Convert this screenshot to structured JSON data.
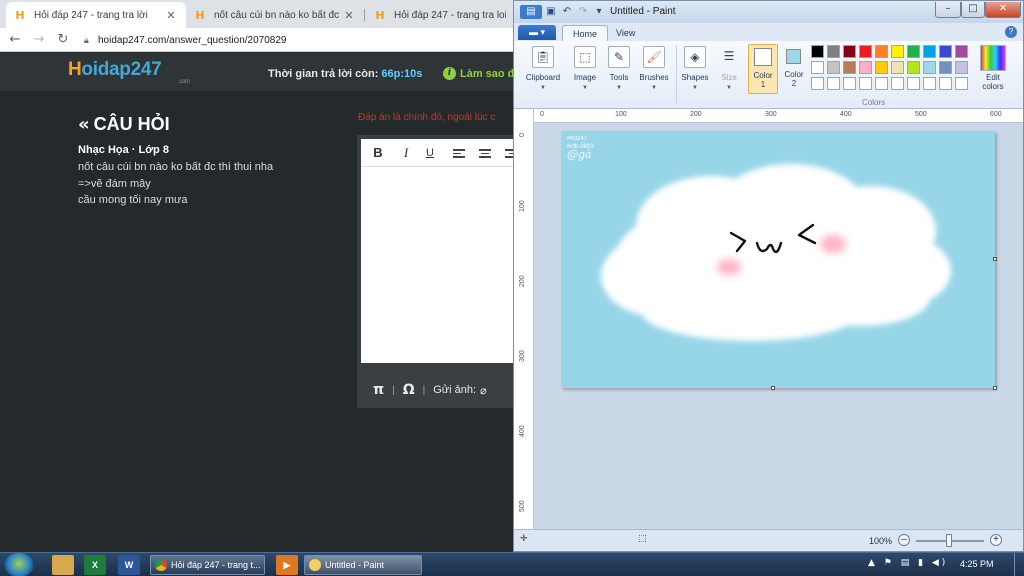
{
  "browser": {
    "tabs": [
      {
        "title": "Hỏi đáp 247 - trang tra lời",
        "close": "✕"
      },
      {
        "title": "nốt câu cúi bn nào ko bất đc thì t",
        "close": "✕"
      },
      {
        "title": "Hỏi đáp 247 - trang tra loi",
        "close": ""
      }
    ],
    "url": "hoidap247.com/answer_question/2070829"
  },
  "site": {
    "logo_h": "H",
    "logo_rest": "oidap247",
    "logo_sub": ".com",
    "timer_label": "Thời gian trả lời còn: ",
    "timer_value": "66p:10s",
    "help_label": "Làm sao đ"
  },
  "question": {
    "heading": "CÂU HỎI",
    "meta": "Nhạc Họa · Lớp 8",
    "lines": [
      "nốt câu cúi bn nào ko bất đc thì thui nha",
      "=>vẽ đám mây",
      "cầu mong tối nay mưa"
    ],
    "answer_note": "Đáp án là chính đó, ngoài lúc c"
  },
  "editor": {
    "bold": "B",
    "italic": "I",
    "underline": "U",
    "pi": "π",
    "omega": "Ω",
    "send_image": "Gửi ảnh:"
  },
  "paint": {
    "title": "Untitled - Paint",
    "tabs": [
      "Home",
      "View"
    ],
    "groups": [
      "Clipboard",
      "Image",
      "Tools",
      "Brushes",
      "Shapes",
      "Size"
    ],
    "color1_label": "Color\n1",
    "color2_label": "Color\n2",
    "colors_label": "Colors",
    "edit_colors": "Edit\ncolors",
    "palette": [
      "#000000",
      "#7f7f7f",
      "#880015",
      "#ed1c24",
      "#ff7f27",
      "#fff200",
      "#22b14c",
      "#00a2e8",
      "#3f48cc",
      "#a349a4",
      "#ffffff",
      "#c3c3c3",
      "#b97a57",
      "#ffaec9",
      "#ffc90e",
      "#efe4b0",
      "#b5e61d",
      "#99d9ea",
      "#7092be",
      "#c8bfe7"
    ],
    "ruler_top": [
      "0",
      "100",
      "200",
      "300",
      "400",
      "500",
      "600"
    ],
    "ruler_left": [
      "0",
      "100",
      "200",
      "300",
      "400",
      "500"
    ],
    "canvas_color": "#97d6e8",
    "watermark": [
      "#hd247",
      "#ctb-0803",
      "@gà"
    ],
    "face_text": ">ω<",
    "zoom": "100%"
  },
  "taskbar": {
    "buttons": [
      "Hỏi đáp 247 - trang t...",
      "Untitled - Paint"
    ],
    "clock": "4:25 PM"
  }
}
